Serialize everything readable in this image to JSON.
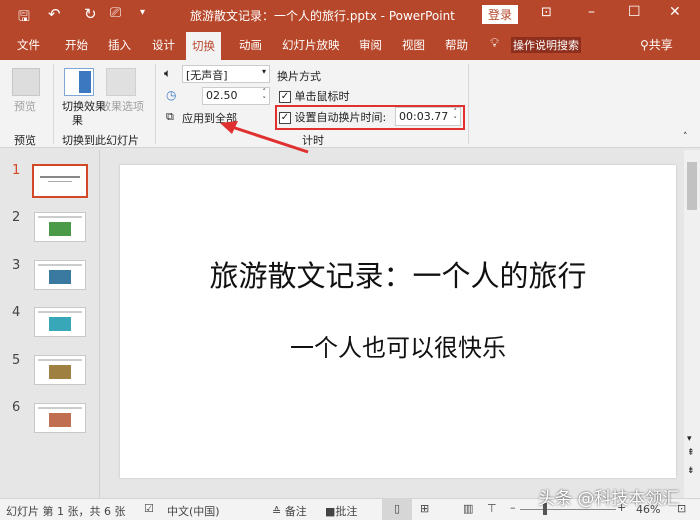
{
  "titlebar": {
    "title": "旅游散文记录：一个人的旅行.pptx  -  PowerPoint",
    "login": "登录",
    "icons": [
      "save-icon",
      "undo-icon",
      "redo-icon",
      "present-icon",
      "customize-icon",
      "ribbon-display-icon",
      "minimize-icon",
      "maximize-icon",
      "close-icon"
    ]
  },
  "tabs": [
    {
      "label": "文件"
    },
    {
      "label": "开始"
    },
    {
      "label": "插入"
    },
    {
      "label": "设计"
    },
    {
      "label": "切换",
      "active": true
    },
    {
      "label": "动画"
    },
    {
      "label": "幻灯片放映"
    },
    {
      "label": "审阅"
    },
    {
      "label": "视图"
    },
    {
      "label": "帮助"
    }
  ],
  "tellme": "操作说明搜索",
  "share": "共享",
  "ribbon": {
    "preview": {
      "button": "预览",
      "group": "预览"
    },
    "transition": {
      "effect": "切换效果",
      "effect2": "果",
      "options": "效果选项",
      "group": "切换到此幻灯片"
    },
    "timing": {
      "sound": "[无声音]",
      "duration": "02.50",
      "apply_all": "应用到全部",
      "advance_label": "换片方式",
      "on_click": "单击鼠标时",
      "on_click_checked": true,
      "auto_label": "设置自动换片时间:",
      "auto_checked": true,
      "auto_time": "00:03.77",
      "group": "计时"
    }
  },
  "slides": [
    {
      "num": "1"
    },
    {
      "num": "2"
    },
    {
      "num": "3"
    },
    {
      "num": "4"
    },
    {
      "num": "5"
    },
    {
      "num": "6"
    }
  ],
  "slide": {
    "title": "旅游散文记录：一个人的旅行",
    "subtitle": "一个人也可以很快乐"
  },
  "status": {
    "slide_info": "幻灯片 第 1 张，共 6 张",
    "language": "中文(中国)",
    "notes": "备注",
    "comments": "批注",
    "zoom": "46%"
  },
  "watermark": "头条 @科技本领汇",
  "colors": {
    "accent": "#b7472a",
    "highlight": "#e03030"
  }
}
